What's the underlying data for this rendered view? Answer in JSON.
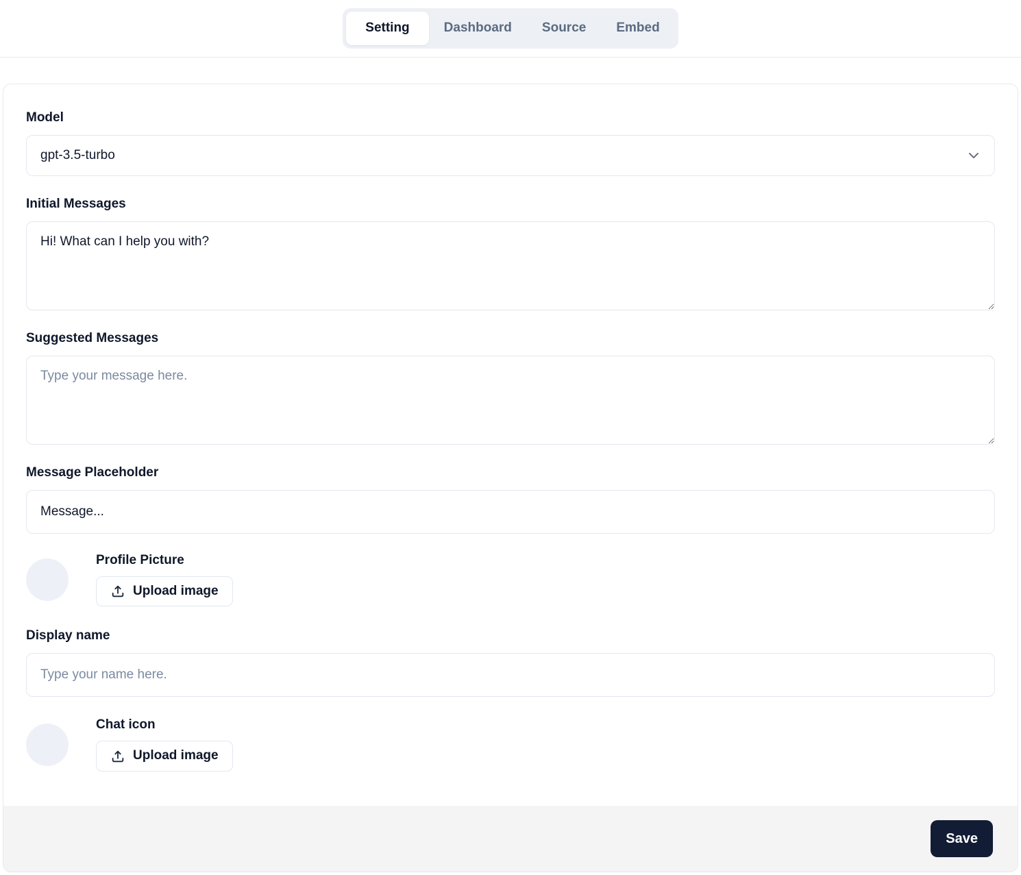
{
  "tabs": {
    "items": [
      {
        "label": "Setting",
        "active": true
      },
      {
        "label": "Dashboard",
        "active": false
      },
      {
        "label": "Source",
        "active": false
      },
      {
        "label": "Embed",
        "active": false
      }
    ]
  },
  "form": {
    "model": {
      "label": "Model",
      "value": "gpt-3.5-turbo"
    },
    "initial_messages": {
      "label": "Initial Messages",
      "value": "Hi! What can I help you with?"
    },
    "suggested_messages": {
      "label": "Suggested Messages",
      "placeholder": "Type your message here."
    },
    "message_placeholder": {
      "label": "Message Placeholder",
      "value": "Message..."
    },
    "profile_picture": {
      "label": "Profile Picture",
      "button_label": "Upload image"
    },
    "display_name": {
      "label": "Display name",
      "placeholder": "Type your name here."
    },
    "chat_icon": {
      "label": "Chat icon",
      "button_label": "Upload image"
    }
  },
  "footer": {
    "save_label": "Save"
  },
  "icons": {
    "chevron_down": "chevron-down-icon",
    "upload": "upload-icon"
  },
  "colors": {
    "accent_dark": "#131c35",
    "tab_bar_bg": "#edf0f4",
    "card_border": "#e7e9ee",
    "input_border": "#e2e8f0",
    "text": "#0f172a",
    "muted_text": "#5b6b80",
    "placeholder": "#7b8aa0",
    "avatar_bg": "#edf1f7",
    "footer_bg": "#f4f4f5"
  }
}
